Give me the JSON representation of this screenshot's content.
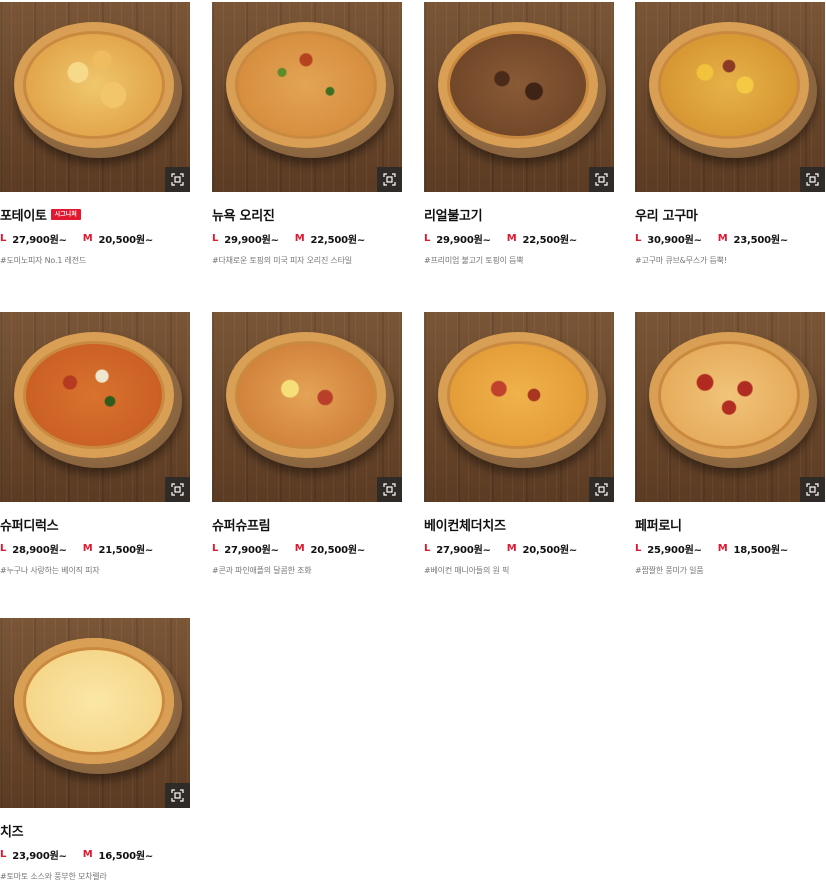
{
  "size_l_label": "L",
  "size_m_label": "M",
  "zoom_icon": "zoom-expand-icon",
  "products": [
    {
      "name": "포테이토",
      "badge": "시그니처",
      "price_l": "27,900원~",
      "price_m": "20,500원~",
      "tagline": "#도미노피자 No.1 레전드"
    },
    {
      "name": "뉴욕 오리진",
      "badge": "",
      "price_l": "29,900원~",
      "price_m": "22,500원~",
      "tagline": "#다채로운 토핑의 미국 피자 오리진 스타일"
    },
    {
      "name": "리얼불고기",
      "badge": "",
      "price_l": "29,900원~",
      "price_m": "22,500원~",
      "tagline": "#프리미엄 불고기 토핑이 듬뿍"
    },
    {
      "name": "우리 고구마",
      "badge": "",
      "price_l": "30,900원~",
      "price_m": "23,500원~",
      "tagline": "#고구마 큐브&무스가 듬뿍!"
    },
    {
      "name": "슈퍼디럭스",
      "badge": "",
      "price_l": "28,900원~",
      "price_m": "21,500원~",
      "tagline": "#누구나 사랑하는 베이직 피자"
    },
    {
      "name": "슈퍼슈프림",
      "badge": "",
      "price_l": "27,900원~",
      "price_m": "20,500원~",
      "tagline": "#콘과 파인애플의 달콤한 조화"
    },
    {
      "name": "베이컨체더치즈",
      "badge": "",
      "price_l": "27,900원~",
      "price_m": "20,500원~",
      "tagline": "#베이컨 매니아들의 원 픽"
    },
    {
      "name": "페퍼로니",
      "badge": "",
      "price_l": "25,900원~",
      "price_m": "18,500원~",
      "tagline": "#짭짤한 풍미가 일품"
    },
    {
      "name": "치즈",
      "badge": "",
      "price_l": "23,900원~",
      "price_m": "16,500원~",
      "tagline": "#토마토 소스와 풍부한 모차렐라"
    }
  ]
}
